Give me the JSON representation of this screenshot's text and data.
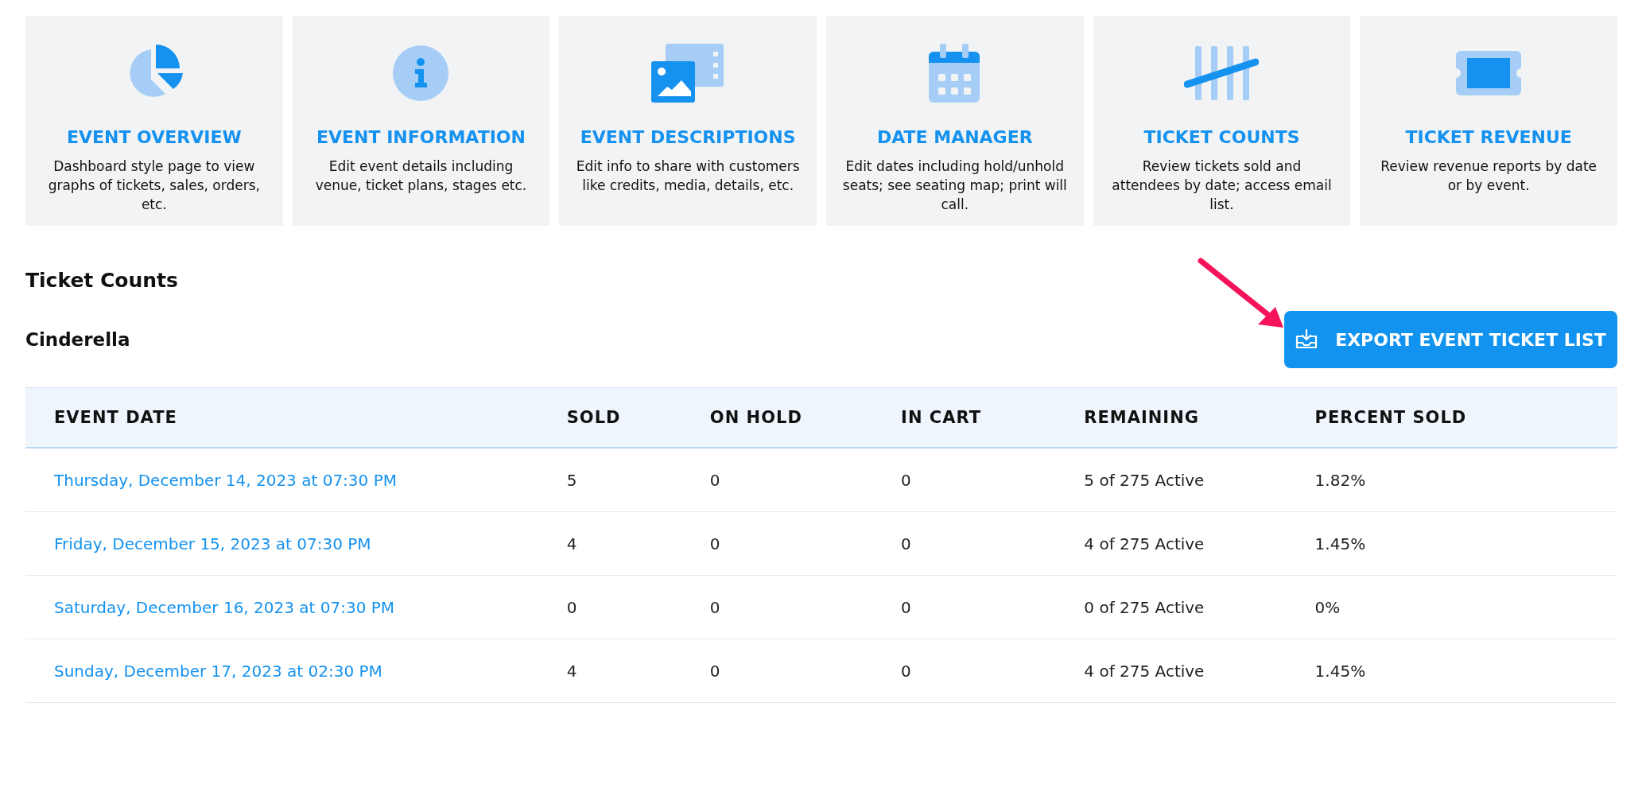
{
  "cards": [
    {
      "title": "EVENT OVERVIEW",
      "description": "Dashboard style page to view graphs of tickets, sales, orders, etc."
    },
    {
      "title": "EVENT INFORMATION",
      "description": "Edit event details including venue, ticket plans, stages etc."
    },
    {
      "title": "EVENT DESCRIPTIONS",
      "description": "Edit info to share with customers like credits, media, details, etc."
    },
    {
      "title": "DATE MANAGER",
      "description": "Edit dates including hold/unhold seats; see seating map; print will call."
    },
    {
      "title": "TICKET COUNTS",
      "description": "Review tickets sold and attendees by date; access email list."
    },
    {
      "title": "TICKET REVENUE",
      "description": "Review revenue reports by date or by event."
    }
  ],
  "section_title": "Ticket Counts",
  "event_name": "Cinderella",
  "export_button": "EXPORT EVENT TICKET LIST",
  "table": {
    "columns": [
      "EVENT DATE",
      "SOLD",
      "ON HOLD",
      "IN CART",
      "REMAINING",
      "PERCENT SOLD"
    ],
    "rows": [
      [
        "Thursday, December 14, 2023 at 07:30 PM",
        "5",
        "0",
        "0",
        "5 of 275 Active",
        "1.82%"
      ],
      [
        "Friday, December 15, 2023 at 07:30 PM",
        "4",
        "0",
        "0",
        "4 of 275 Active",
        "1.45%"
      ],
      [
        "Saturday, December 16, 2023 at 07:30 PM",
        "0",
        "0",
        "0",
        "0 of 275 Active",
        "0%"
      ],
      [
        "Sunday, December 17, 2023 at 02:30 PM",
        "4",
        "0",
        "0",
        "4 of 275 Active",
        "1.45%"
      ]
    ]
  }
}
